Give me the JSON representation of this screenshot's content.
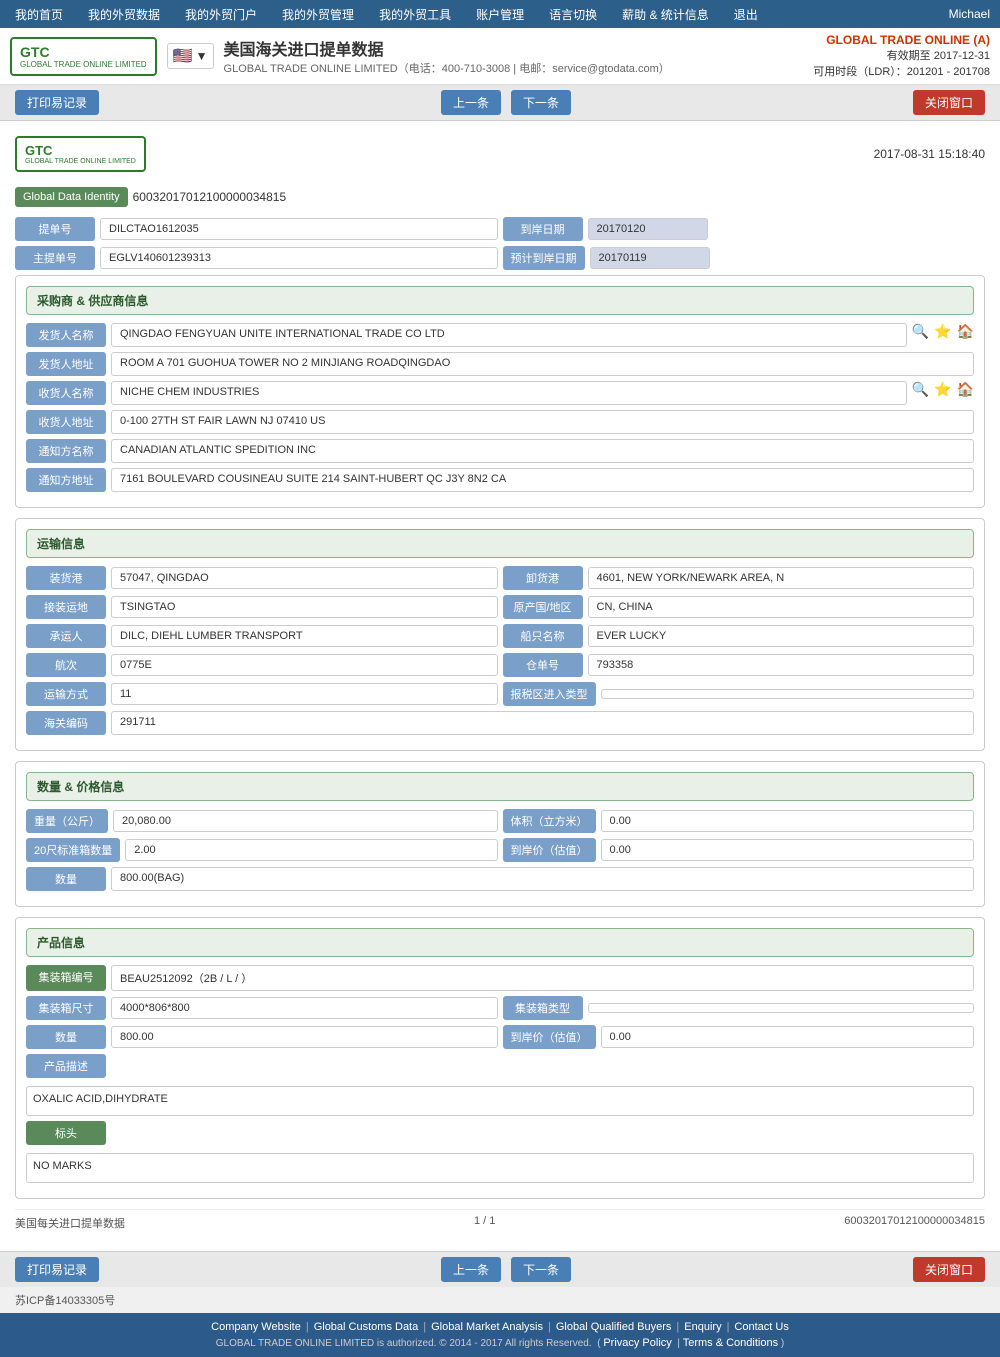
{
  "topNav": {
    "items": [
      {
        "label": "我的首页",
        "id": "home"
      },
      {
        "label": "我的外贸数据",
        "id": "trade-data"
      },
      {
        "label": "我的外贸门户",
        "id": "portal"
      },
      {
        "label": "我的外贸管理",
        "id": "management"
      },
      {
        "label": "我的外贸工具",
        "id": "tools"
      },
      {
        "label": "账户管理",
        "id": "account"
      },
      {
        "label": "语言切换",
        "id": "language"
      },
      {
        "label": "薪助 & 统计信息",
        "id": "stats"
      },
      {
        "label": "退出",
        "id": "logout"
      }
    ],
    "user": "Michael"
  },
  "header": {
    "title": "美国海关进口提单数据",
    "subtitle": "GLOBAL TRADE ONLINE LIMITED（电话：400-710-3008 | 电邮：service@gtodata.com）",
    "companyName": "GLOBAL TRADE ONLINE (A)",
    "expiry": "有效期至 2017-12-31",
    "ldr": "可用时段（LDR）：201201 - 201708"
  },
  "toolbar": {
    "printLabel": "打印易记录",
    "prevLabel": "上一条",
    "nextLabel": "下一条",
    "closeLabel": "关闭窗口"
  },
  "doc": {
    "datetime": "2017-08-31 15:18:40",
    "globalDataIdentity": "60032017012100000034815",
    "fields": {
      "提单号": "DILCTAO1612035",
      "主提单号": "EGLV140601239313",
      "到岸日期": "20170120",
      "预计到岸日期": "20170119"
    }
  },
  "sections": {
    "buyerSupplier": {
      "title": "采购商 & 供应商信息",
      "fields": {
        "发货人名称": "QINGDAO FENGYUAN UNITE INTERNATIONAL TRADE CO LTD",
        "发货人地址": "ROOM A 701 GUOHUA TOWER NO 2 MINJIANG ROADQINGDAO",
        "收货人名称": "NICHE CHEM INDUSTRIES",
        "收货人地址": "0-100 27TH ST FAIR LAWN NJ 07410 US",
        "通知方名称": "CANADIAN ATLANTIC SPEDITION INC",
        "通知方地址": "7161 BOULEVARD COUSINEAU SUITE 214 SAINT-HUBERT QC J3Y 8N2 CA"
      }
    },
    "transport": {
      "title": "运输信息",
      "fields": {
        "装货港": "57047, QINGDAO",
        "卸货港": "4601, NEW YORK/NEWARK AREA, N",
        "接装运地": "TSINGTAO",
        "原产国/地区": "CN, CHINA",
        "承运人": "DILC, DIEHL LUMBER TRANSPORT",
        "船只名称": "EVER LUCKY",
        "航次": "0775E",
        "仓单号": "793358",
        "运输方式": "11",
        "报税区进入类型": "",
        "海关编码": "291711"
      }
    },
    "quantity": {
      "title": "数量 & 价格信息",
      "fields": {
        "重量（公斤）": "20,080.00",
        "体积（立方米）": "0.00",
        "20尺标准箱数量": "2.00",
        "到岸价（估值）": "0.00",
        "数量": "800.00(BAG)"
      }
    },
    "product": {
      "title": "产品信息",
      "fields": {
        "集装箱编号": "BEAU2512092（2B / L / ）",
        "集装箱尺寸": "4000*806*800",
        "集装箱类型": "",
        "数量": "800.00",
        "到岸价（估值）": "0.00",
        "产品描述": "OXALIC ACID,DIHYDRATE",
        "标头": "NO MARKS"
      }
    }
  },
  "pageInfo": {
    "title": "美国每关进口提单数据",
    "page": "1 / 1",
    "id": "60032017012100000034815"
  },
  "footer": {
    "links": [
      {
        "label": "Company Website"
      },
      {
        "label": "Global Customs Data"
      },
      {
        "label": "Global Market Analysis"
      },
      {
        "label": "Global Qualified Buyers"
      },
      {
        "label": "Enquiry"
      },
      {
        "label": "Contact Us"
      }
    ],
    "copyright": "GLOBAL TRADE ONLINE LIMITED is authorized. © 2014 - 2017 All rights Reserved.",
    "privacy": "Privacy Policy",
    "terms": "Terms & Conditions",
    "beian": "苏ICP备14033305号"
  }
}
